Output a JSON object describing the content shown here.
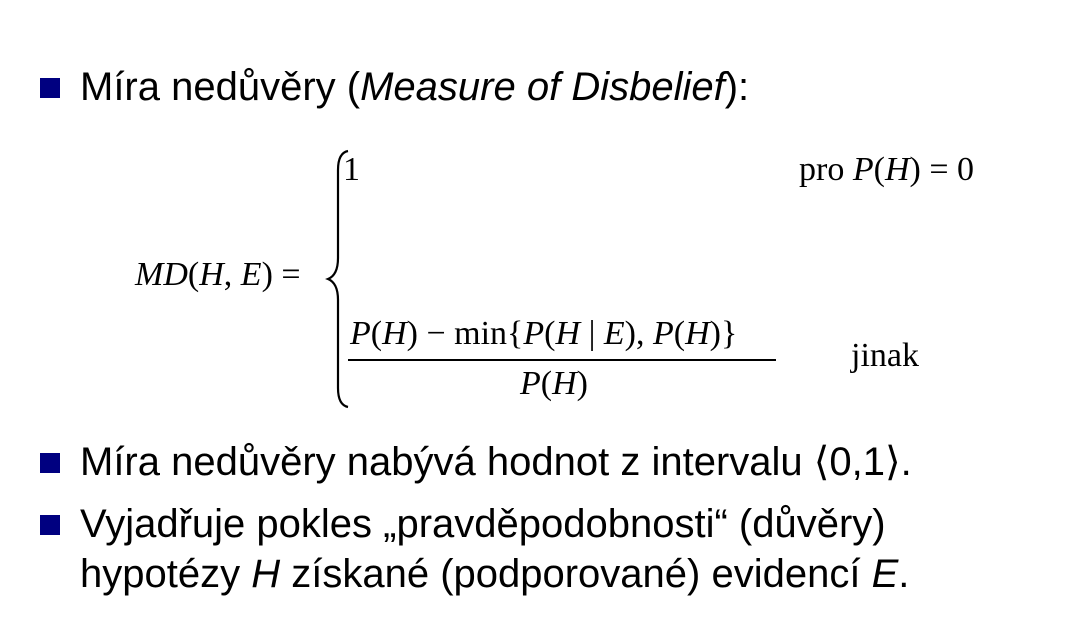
{
  "bullet_color": "#000080",
  "bullet1": {
    "prefix": "Míra nedůvěry (",
    "italic": "Measure of Disbelief",
    "suffix": "):"
  },
  "formula": {
    "lhs_md": "MD",
    "lhs_paren_open": "(",
    "lhs_h": "H",
    "lhs_comma": ", ",
    "lhs_e": "E",
    "lhs_close_eq": ") =",
    "case1_value": "1",
    "case1_cond_pro": "pro ",
    "case1_cond_p": "P",
    "case1_cond_po": "(",
    "case1_cond_h": "H",
    "case1_cond_rest": ") = 0",
    "num_p1": "P",
    "num_po1": "(",
    "num_h1": "H",
    "num_minmin": ") − min{",
    "num_p2": "P",
    "num_po2": "(",
    "num_h2": "H",
    "num_bar": " | ",
    "num_e": "E",
    "num_pc2": "), ",
    "num_p3": "P",
    "num_po3": "(",
    "num_h3": "H",
    "num_end": ")}",
    "den_p": "P",
    "den_po": "(",
    "den_h": "H",
    "den_pc": ")",
    "case2_cond": "jinak"
  },
  "bullet2": {
    "text": "Míra nedůvěry nabývá hodnot z intervalu ⟨0,1⟩."
  },
  "bullet3": {
    "line1": "Vyjadřuje pokles „pravděpodobnosti“ (důvěry)",
    "line2_a": "hypotézy ",
    "line2_h": "H",
    "line2_b": " získané (podporované) evidencí ",
    "line2_e": "E",
    "line2_c": "."
  }
}
